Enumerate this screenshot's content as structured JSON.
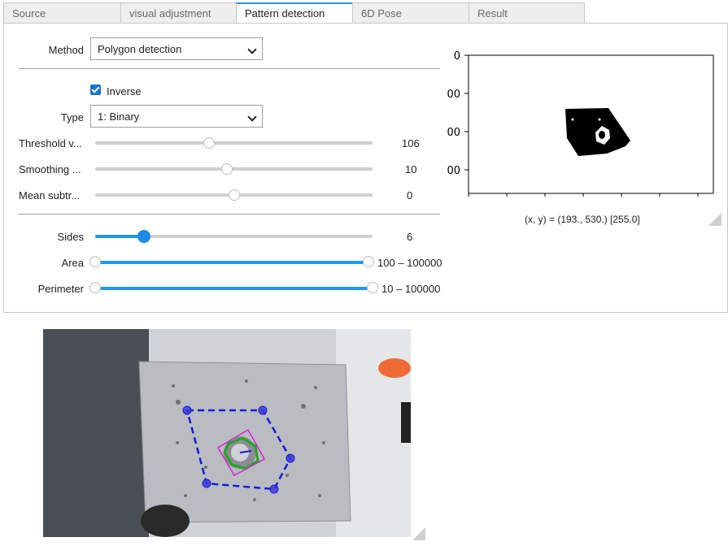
{
  "tabs": [
    "Source",
    "visual adjustment",
    "Pattern detection",
    "6D Pose",
    "Result"
  ],
  "active_tab": "Pattern detection",
  "method": {
    "label": "Method",
    "value": "Polygon detection"
  },
  "inverse": {
    "label": "Inverse",
    "checked": true
  },
  "type": {
    "label": "Type",
    "value": "1: Binary"
  },
  "sliders": [
    {
      "label": "Threshold v...",
      "value": "106",
      "fraction": 0.41
    },
    {
      "label": "Smoothing ...",
      "value": "10",
      "fraction": 0.475
    },
    {
      "label": "Mean subtr...",
      "value": "0",
      "fraction": 0.5
    }
  ],
  "sides": {
    "label": "Sides",
    "value": "6",
    "fraction": 0.175
  },
  "area": {
    "label": "Area",
    "value": "100 – 100000",
    "range": [
      100,
      100000
    ]
  },
  "perimeter": {
    "label": "Perimeter",
    "value": "10 – 100000",
    "range": [
      10,
      100000
    ]
  },
  "preview": {
    "y_ticks": [
      "0",
      "00",
      "00",
      "00"
    ],
    "coord_readout": "(x, y) = (193., 530.) [255.0]"
  },
  "colors": {
    "accent": "#2196f3",
    "polygon": "#1a1adc",
    "contour_green": "#1fa81f",
    "rect_magenta": "#e020e0"
  }
}
